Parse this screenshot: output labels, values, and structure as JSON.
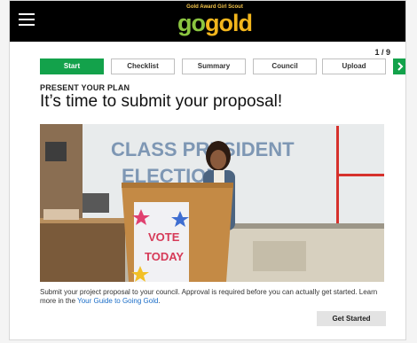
{
  "header": {
    "logo_tagline": "Gold Award Girl Scout",
    "logo_go": "go",
    "logo_gold": "gold",
    "menu_icon": "hamburger-menu-icon"
  },
  "progress": {
    "counter": "1 / 9"
  },
  "steps": [
    {
      "label": "Start",
      "active": true
    },
    {
      "label": "Checklist",
      "active": false
    },
    {
      "label": "Summary",
      "active": false
    },
    {
      "label": "Council",
      "active": false
    },
    {
      "label": "Upload",
      "active": false
    }
  ],
  "next_icon": "chevron-right-icon",
  "section": {
    "kicker": "PRESENT YOUR PLAN",
    "headline": "It’s time to submit your proposal!"
  },
  "photo": {
    "board_text_1": "CLASS PRESIDENT",
    "board_text_2": "ELECTION",
    "poster_text_1": "VOTE",
    "poster_text_2": "TODAY"
  },
  "description": {
    "text": "Submit your project proposal to your council. Approval is required before you can actually get started. Learn more in the ",
    "link": "Your Guide to Going Gold",
    "end": "."
  },
  "actions": {
    "primary": "Get Started"
  },
  "colors": {
    "accent_green": "#13a24b",
    "logo_gold": "#f2b51c",
    "logo_green": "#8bc540",
    "link_blue": "#1c6ec8"
  }
}
